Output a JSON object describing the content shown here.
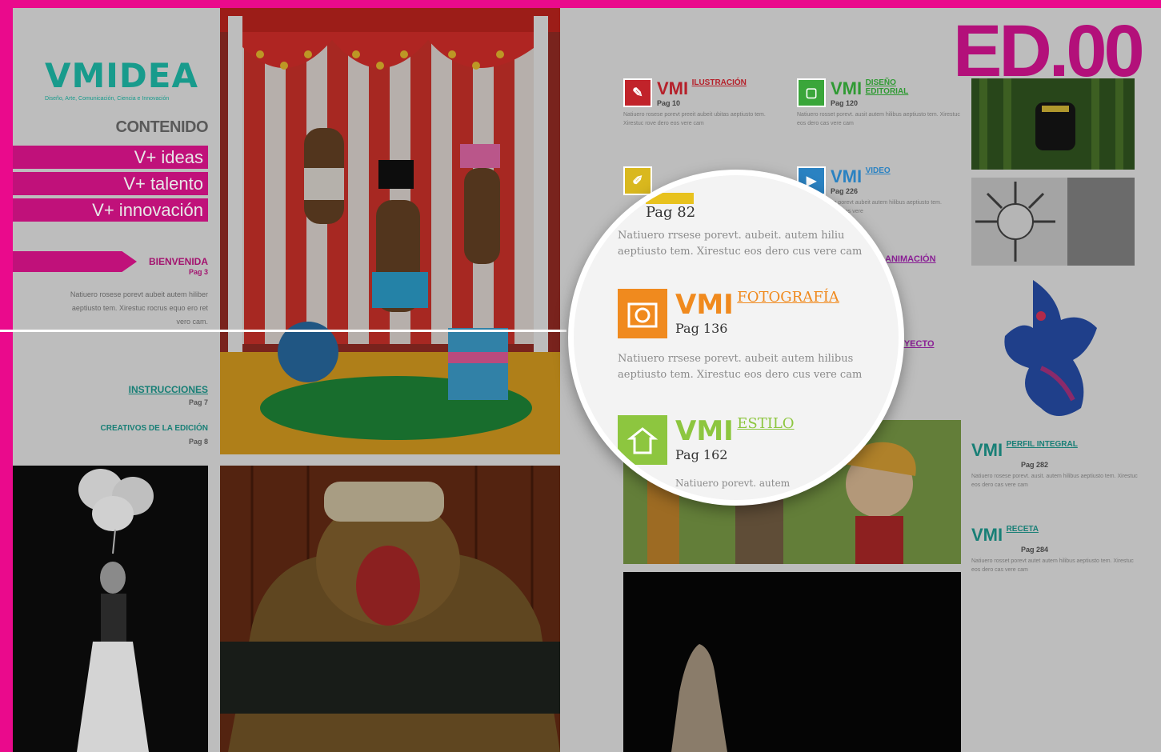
{
  "logo": {
    "title": "VMIDEA",
    "subtitle": "Diseño, Arte, Comunicación, Ciencia e Innovación"
  },
  "sidebar": {
    "heading": "CONTENIDO",
    "items": [
      {
        "label": "V+ ideas"
      },
      {
        "label": "V+ talento"
      },
      {
        "label": "V+ innovación"
      }
    ],
    "welcome": {
      "title": "BIENVENIDA",
      "page": "Pag 3",
      "text": "Natiuero rosese porevt aubeit autem hiliber aeptiusto tem. Xirestuc rocrus equo ero ret vero cam."
    },
    "instructions": {
      "title": "INSTRUCCIONES",
      "page": "Pag 7"
    },
    "creatives": {
      "title": "CREATIVOS DE LA EDICIÓN",
      "page": "Pag 8"
    }
  },
  "edition": "ED.00",
  "sections": [
    {
      "brand": "VMI",
      "title": "ILUSTRACIÓN",
      "page": "Pag 10",
      "text": "Natiuero rosese porevt preeit aubeit ubitas aeptiusto tem. Xirestuc rove dero eos vere cam",
      "color": "#d3222a"
    },
    {
      "brand": "VMI",
      "title": "DISEÑO EDITORIAL",
      "page": "Pag 120",
      "text": "Natiuero rosset porevt. ausit autem hilibus aeptiusto tem. Xirestuc eos dero cas vere cam",
      "color": "#3dbb3a"
    },
    {
      "brand": "VMI",
      "title": "VIDEO",
      "page": "Pag 226",
      "text": "Natiuero rosese porevt aubeit autem hilibus aeptiusto tem. Xirestuc eos dero cas vere",
      "color": "#2a8fd1"
    },
    {
      "brand": "VMI",
      "title": "ANIMACIÓN",
      "page": "",
      "text": "",
      "color": "#b524b9"
    },
    {
      "brand": "VMI",
      "title": "PROYECTO",
      "page": "",
      "text": "",
      "color": "#b524b9"
    }
  ],
  "right_sections": [
    {
      "brand": "VMI",
      "title": "PERFIL INTEGRAL",
      "page": "Pag 282",
      "text": "Natiuero rosese porevt. ausit. autem hilibus aeptiusto tem. Xirestuc eos dero cas vere cam"
    },
    {
      "brand": "VMI",
      "title": "RECETA",
      "page": "Pag 284",
      "text": "Natiuero rosset porevt autet autem hilibus aeptiusto tem. Xirestuc eos dero cas vere cam"
    }
  ],
  "magnifier": {
    "top_page": "Pag 82",
    "top_text": "Natiuero rrsese porevt. aubeit. autem hiliu aeptiusto tem. Xirestuc eos dero cus vere cam",
    "foto": {
      "brand": "VMI",
      "title": "FOTOGRAFÍA",
      "page": "Pag 136",
      "text": "Natiuero rrsese porevt. aubeit autem hilibus aeptiusto tem. Xirestuc eos dero cus vere cam"
    },
    "estilo": {
      "brand": "VMI",
      "title": "ESTILO",
      "page": "Pag 162",
      "text": "Natiuero porevt. autem"
    }
  },
  "colors": {
    "frame": "#ea0a8c",
    "accent": "#c0117a",
    "teal": "#189b8c",
    "foto": "#f08a1e",
    "estilo": "#8dc63f"
  }
}
